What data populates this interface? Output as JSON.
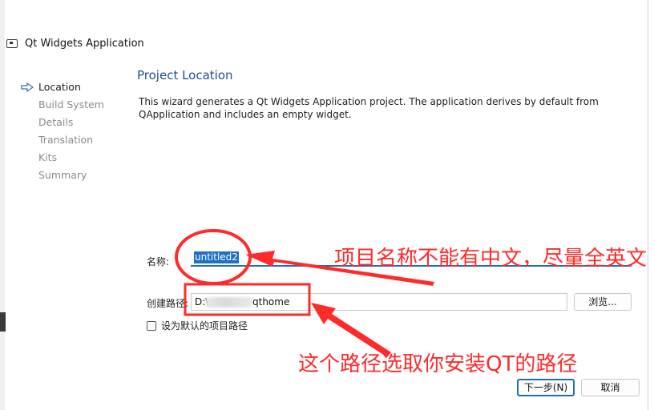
{
  "window": {
    "title": "Qt Widgets Application"
  },
  "steps": [
    {
      "label": "Location",
      "active": true
    },
    {
      "label": "Build System",
      "active": false
    },
    {
      "label": "Details",
      "active": false
    },
    {
      "label": "Translation",
      "active": false
    },
    {
      "label": "Kits",
      "active": false
    },
    {
      "label": "Summary",
      "active": false
    }
  ],
  "page": {
    "heading": "Project Location",
    "description": "This wizard generates a Qt Widgets Application project. The application derives by default from QApplication and includes an empty widget."
  },
  "form": {
    "name_label": "名称:",
    "name_value": "untitled2",
    "path_label": "创建路径:",
    "path_prefix": "D:\\",
    "path_suffix": "qthome",
    "browse_label": "浏览...",
    "default_checkbox_label": "设为默认的项目路径",
    "default_checked": false
  },
  "buttons": {
    "next_label": "下一步(N)",
    "cancel_label": "取消"
  },
  "annotations": {
    "note_name": "项目名称不能有中文，尽量全英文",
    "note_path": "这个路径选取你安装QT的路径",
    "color": "#ff2a2a"
  },
  "colors": {
    "accent": "#1f6fb2",
    "heading": "#1d4f91",
    "selection": "#1e6fc7"
  }
}
